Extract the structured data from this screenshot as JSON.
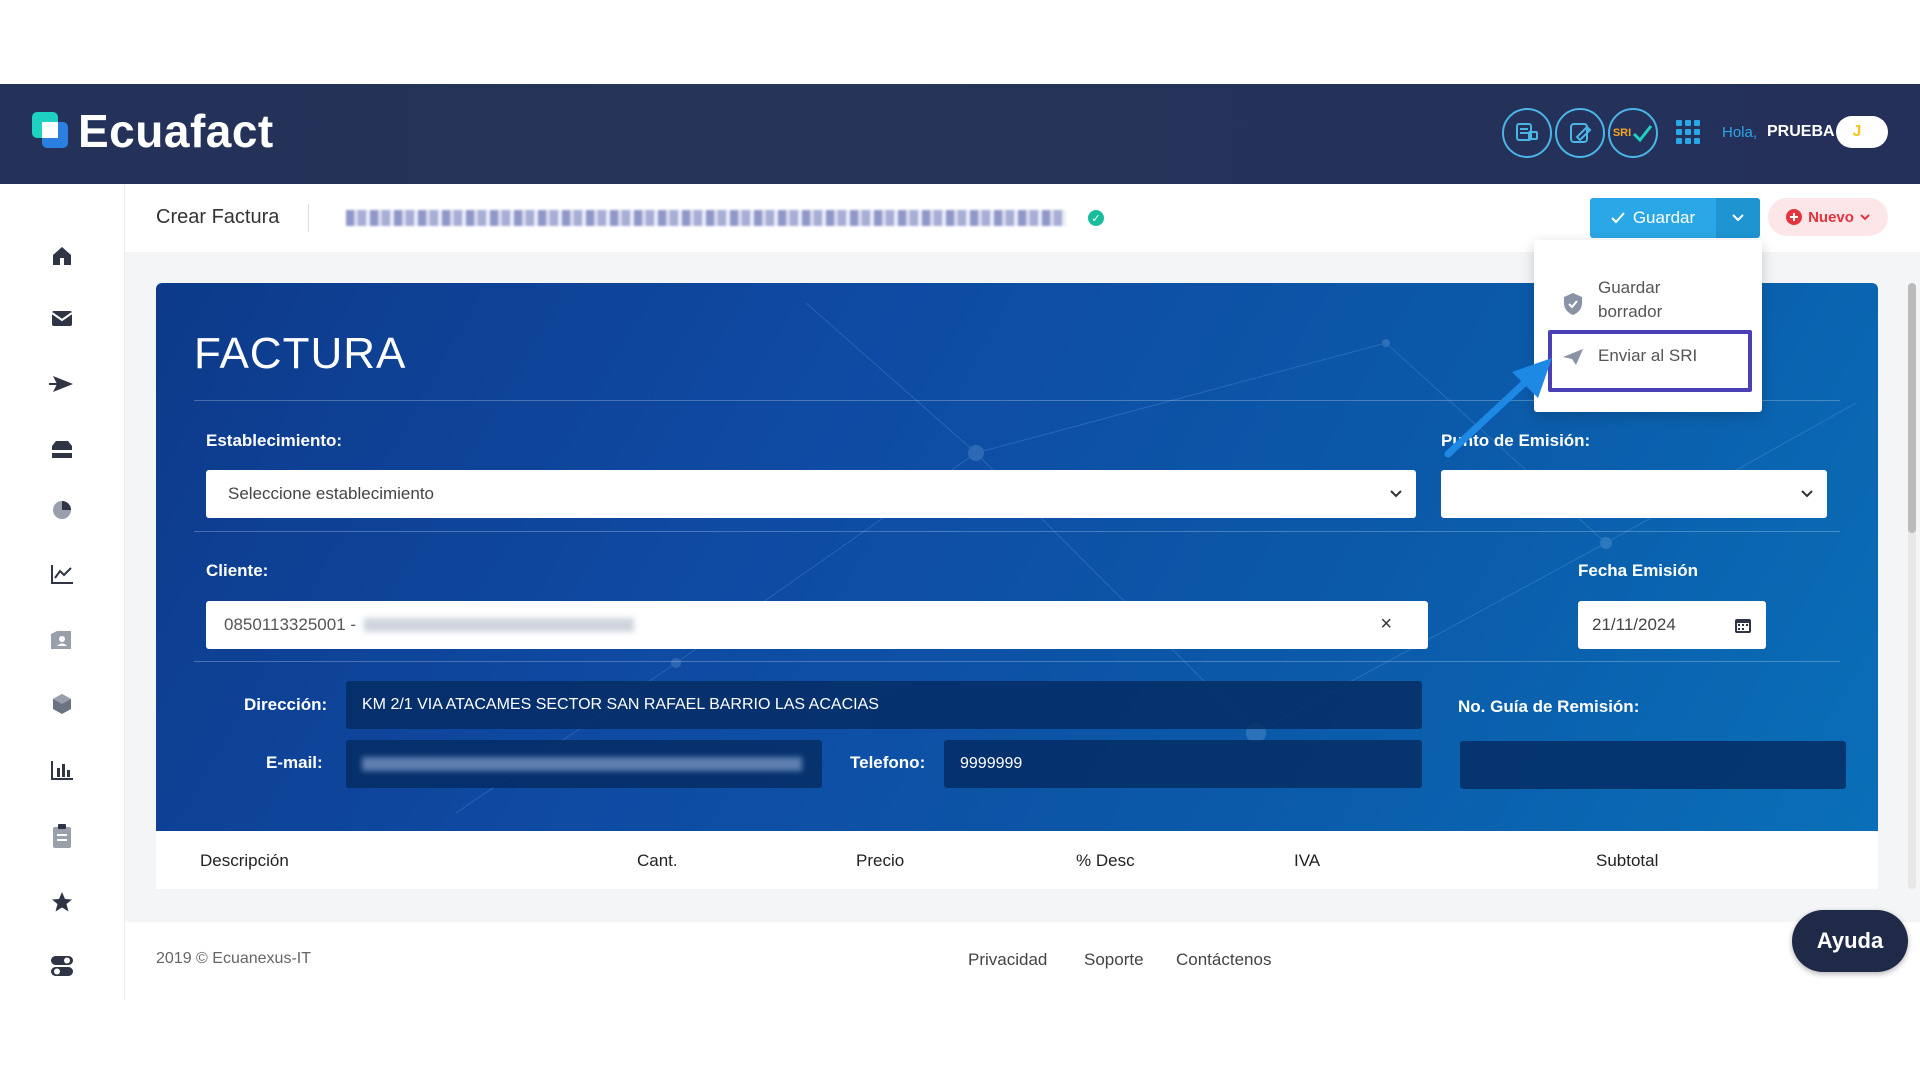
{
  "app": {
    "name": "Ecuafact"
  },
  "header": {
    "greeting": "Hola,",
    "user_name": "PRUEBA",
    "avatar_initial": "J",
    "sri_label": "SRI",
    "icons": [
      "document-truck-icon",
      "edit-document-icon",
      "sri-check-icon",
      "apps-grid-icon"
    ]
  },
  "sidebar": {
    "items": [
      "home-icon",
      "inbox-icon",
      "send-icon",
      "tray-icon",
      "pie-chart-icon",
      "line-chart-icon",
      "contacts-icon",
      "box-icon",
      "bar-chart-icon",
      "clipboard-icon",
      "star-icon",
      "toggle-icon"
    ]
  },
  "subheader": {
    "title": "Crear Factura"
  },
  "actions": {
    "guardar_label": "Guardar",
    "nuevo_label": "Nuevo",
    "menu": {
      "guardar_borrador_line1": "Guardar",
      "guardar_borrador_line2": "borrador",
      "enviar_sri": "Enviar al SRI"
    }
  },
  "factura": {
    "title": "FACTURA",
    "establecimiento_label": "Establecimiento:",
    "establecimiento_value": "Seleccione establecimiento",
    "punto_emision_label": "Punto de Emisión:",
    "punto_emision_value": "",
    "cliente_label": "Cliente:",
    "cliente_value": "0850113325001 -",
    "fecha_label": "Fecha Emisión",
    "fecha_value": "21/11/2024",
    "direccion_label": "Dirección:",
    "direccion_value": "KM 2/1 VIA ATACAMES SECTOR SAN RAFAEL BARRIO LAS ACACIAS",
    "email_label": "E-mail:",
    "telefono_label": "Telefono:",
    "telefono_value": "9999999",
    "guia_label": "No. Guía de Remisión:",
    "guia_value": ""
  },
  "table": {
    "columns": [
      "Descripción",
      "Cant.",
      "Precio",
      "% Desc",
      "IVA",
      "Subtotal"
    ]
  },
  "footer": {
    "copyright": "2019 © Ecuanexus-IT",
    "links": [
      "Privacidad",
      "Soporte",
      "Contáctenos"
    ]
  },
  "help_button": "Ayuda",
  "colors": {
    "header_bg": "#243159",
    "accent": "#2aa7e6",
    "panel_blue": "#0f4aa3",
    "nuevo_red": "#e3343f",
    "highlight": "#4b3fb5"
  }
}
